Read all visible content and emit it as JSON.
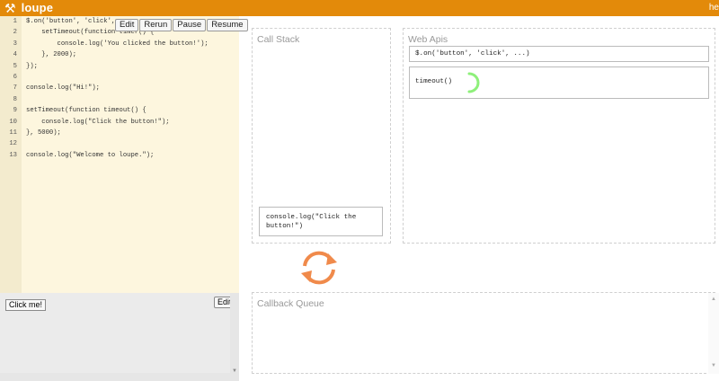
{
  "app": {
    "name": "loupe",
    "help_label": "he"
  },
  "toolbar": {
    "edit": "Edit",
    "rerun": "Rerun",
    "pause": "Pause",
    "resume": "Resume"
  },
  "code_lines": [
    {
      "n": "1",
      "text": "$.on('button', 'click', "
    },
    {
      "n": "2",
      "text": "    setTimeout(function timer() {"
    },
    {
      "n": "3",
      "text": "        console.log('You clicked the button!');"
    },
    {
      "n": "4",
      "text": "    }, 2000);"
    },
    {
      "n": "5",
      "text": "});"
    },
    {
      "n": "6",
      "text": ""
    },
    {
      "n": "7",
      "text": "console.log(\"Hi!\");"
    },
    {
      "n": "8",
      "text": ""
    },
    {
      "n": "9",
      "text": "setTimeout(function timeout() {"
    },
    {
      "n": "10",
      "text": "    console.log(\"Click the button!\");"
    },
    {
      "n": "11",
      "text": "}, 5000);"
    },
    {
      "n": "12",
      "text": ""
    },
    {
      "n": "13",
      "text": "console.log(\"Welcome to loupe.\");"
    }
  ],
  "html_panel": {
    "button_label": "Click me!",
    "edit_label": "Edit"
  },
  "call_stack": {
    "title": "Call Stack",
    "frames": [
      "console.log(\"Click the button!\")"
    ]
  },
  "web_apis": {
    "title": "Web Apis",
    "items": [
      "$.on('button', 'click', ...)",
      "timeout()"
    ]
  },
  "callback_queue": {
    "title": "Callback Queue"
  },
  "colors": {
    "brand": "#e38a0a",
    "spinner": "#8ef07a",
    "refresh": "#f08a4b"
  }
}
